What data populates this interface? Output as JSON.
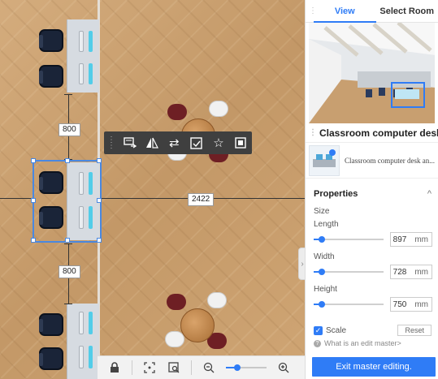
{
  "canvas": {
    "dimension_top": "800",
    "dimension_bottom": "800",
    "dimension_horizontal": "2422"
  },
  "floating_toolbar": {
    "icons": [
      "grip-icon",
      "replace-icon",
      "mirror-icon",
      "swap-icon",
      "material-icon",
      "favorite-icon",
      "group-icon"
    ]
  },
  "bottom_bar": {
    "icons": [
      "lock-icon",
      "fit-view-icon",
      "zoom-area-icon",
      "zoom-out-icon",
      "zoom-slider",
      "zoom-in-icon"
    ],
    "zoom_level": 0.2
  },
  "panel": {
    "tabs": [
      {
        "label": "View",
        "active": true
      },
      {
        "label": "Select Room",
        "active": false
      }
    ],
    "item": {
      "title": "Classroom computer desk...",
      "description": "Classroom computer desk an..."
    },
    "properties": {
      "heading": "Properties",
      "section": "Size",
      "fields": [
        {
          "label": "Length",
          "value": "897",
          "unit": "mm"
        },
        {
          "label": "Width",
          "value": "728",
          "unit": "mm"
        },
        {
          "label": "Height",
          "value": "750",
          "unit": "mm"
        }
      ],
      "scale_label": "Scale",
      "reset_label": "Reset"
    },
    "help_text": "What is an edit master>",
    "exit_button": "Exit master editing."
  },
  "colors": {
    "accent": "#2f7cf6",
    "toolbar_bg": "#3f3f3f",
    "floor": "#c9a172"
  }
}
